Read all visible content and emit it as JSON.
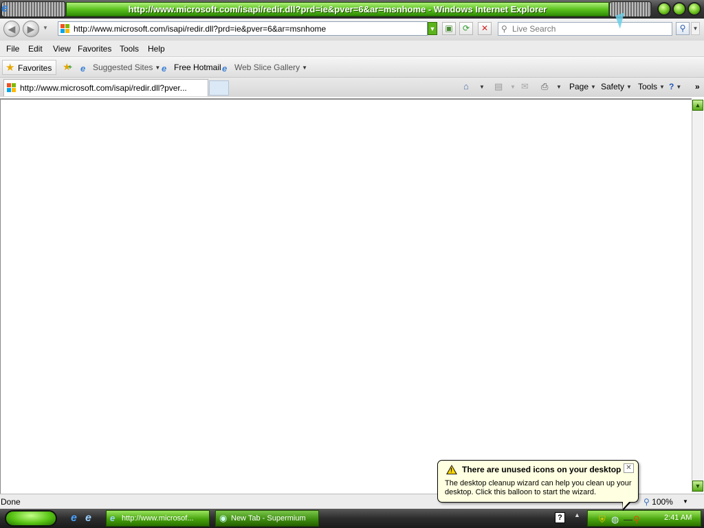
{
  "window": {
    "title": "http://www.microsoft.com/isapi/redir.dll?prd=ie&pver=6&ar=msnhome - Windows Internet Explorer"
  },
  "nav": {
    "back": "◀",
    "forward": "▶"
  },
  "address": {
    "url": "http://www.microsoft.com/isapi/redir.dll?prd=ie&pver=6&ar=msnhome"
  },
  "search": {
    "placeholder": "Live Search"
  },
  "menus": [
    "File",
    "Edit",
    "View",
    "Favorites",
    "Tools",
    "Help"
  ],
  "favorites_bar": {
    "favorites_label": "Favorites",
    "links": [
      "Suggested Sites",
      "Free Hotmail",
      "Web Slice Gallery"
    ]
  },
  "tab": {
    "label": "http://www.microsoft.com/isapi/redir.dll?pver..."
  },
  "command_bar": {
    "page": "Page",
    "safety": "Safety",
    "tools": "Tools",
    "more": "»"
  },
  "status": {
    "text": "Done",
    "zoom": "100%"
  },
  "taskbar": {
    "tasks": [
      "http://www.microsof...",
      "New Tab - Supermium"
    ],
    "clock": "2:41 AM"
  },
  "balloon": {
    "title": "There are unused icons on your desktop",
    "body": "The desktop cleanup wizard can help you clean up your desktop. Click this balloon to start the wizard."
  },
  "colors": {
    "theme_green": "#5cc21e",
    "windows_red": "#f25022",
    "windows_green": "#7fba00",
    "windows_blue": "#00a4ef",
    "windows_yellow": "#ffb900"
  }
}
